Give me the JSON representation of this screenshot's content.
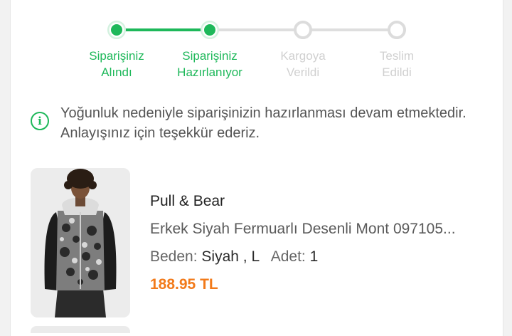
{
  "stepper": {
    "steps": [
      {
        "label": "Siparişiniz\nAlındı",
        "status": "done"
      },
      {
        "label": "Siparişiniz\nHazırlanıyor",
        "status": "done"
      },
      {
        "label": "Kargoya\nVerildi",
        "status": "pending"
      },
      {
        "label": "Teslim\nEdildi",
        "status": "pending"
      }
    ]
  },
  "notice": {
    "icon": "info-icon",
    "text": "Yoğunluk nedeniyle siparişinizin hazırlanması devam etmektedir. Anlayışınız için teşekkür ederiz."
  },
  "product": {
    "brand": "Pull & Bear",
    "name": "Erkek Siyah Fermuarlı Desenli Mont 097105...",
    "size_label": "Beden:",
    "size_value": "Siyah , L",
    "qty_label": "Adet:",
    "qty_value": "1",
    "price": "188.95 TL"
  },
  "colors": {
    "accent": "#1eb85a",
    "pending": "#dcdcdc",
    "price": "#f27a1a"
  }
}
